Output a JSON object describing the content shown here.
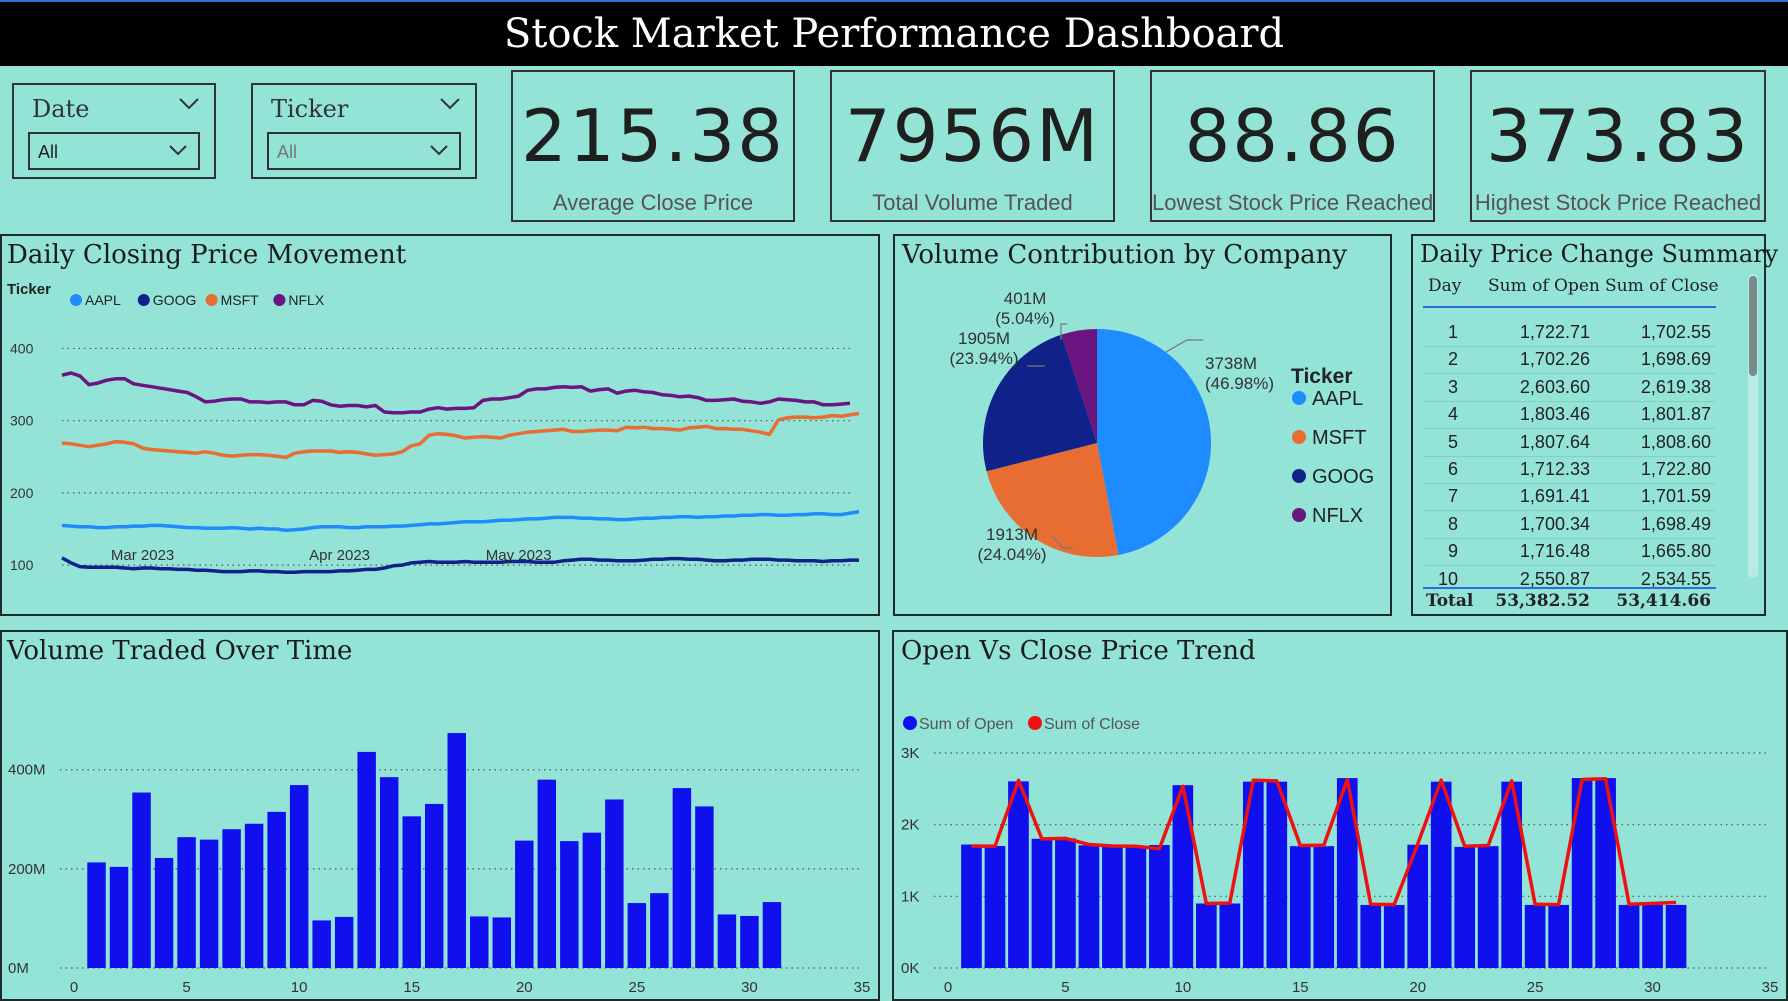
{
  "header": {
    "title": "Stock Market Performance Dashboard"
  },
  "filters": {
    "date": {
      "label": "Date",
      "value": "All"
    },
    "ticker": {
      "label": "Ticker",
      "value": "All"
    }
  },
  "kpis": [
    {
      "value": "215.38",
      "caption": "Average Close Price"
    },
    {
      "value": "7956M",
      "caption": "Total Volume Traded"
    },
    {
      "value": "88.86",
      "caption": "Lowest Stock Price Reached"
    },
    {
      "value": "373.83",
      "caption": "Highest Stock Price Reached"
    }
  ],
  "colors": {
    "AAPL": "#1e8bff",
    "GOOG": "#10228a",
    "MSFT": "#e86d32",
    "NFLX": "#6b1580",
    "bar": "#1010ee",
    "close_line": "#ee1111",
    "open_dot": "#1010ee"
  },
  "table": {
    "title": "Daily Price Change Summary",
    "columns": [
      "Day",
      "Sum of Open",
      "Sum of Close"
    ],
    "rows": [
      [
        "1",
        "1,722.71",
        "1,702.55"
      ],
      [
        "2",
        "1,702.26",
        "1,698.69"
      ],
      [
        "3",
        "2,603.60",
        "2,619.38"
      ],
      [
        "4",
        "1,803.46",
        "1,801.87"
      ],
      [
        "5",
        "1,807.64",
        "1,808.60"
      ],
      [
        "6",
        "1,712.33",
        "1,722.80"
      ],
      [
        "7",
        "1,691.41",
        "1,701.59"
      ],
      [
        "8",
        "1,700.34",
        "1,698.49"
      ],
      [
        "9",
        "1,716.48",
        "1,665.80"
      ],
      [
        "10",
        "2,550.87",
        "2,534.55"
      ]
    ],
    "total": [
      "Total",
      "53,382.52",
      "53,414.66"
    ]
  },
  "chart_data": [
    {
      "type": "line",
      "title": "Daily Closing Price Movement",
      "legend_title": "Ticker",
      "legend": [
        "AAPL",
        "GOOG",
        "MSFT",
        "NFLX"
      ],
      "x_ticks": [
        "Mar 2023",
        "Apr 2023",
        "May 2023"
      ],
      "x_tick_index": [
        9,
        31,
        51
      ],
      "ylim": [
        60,
        420
      ],
      "y_ticks": [
        "100",
        "200",
        "300",
        "400"
      ],
      "grid": true,
      "series": [
        {
          "name": "NFLX",
          "values": [
            363,
            366,
            362,
            350,
            352,
            356,
            358,
            358,
            351,
            349,
            347,
            345,
            343,
            341,
            339,
            333,
            326,
            327,
            329,
            330,
            330,
            326,
            326,
            325,
            326,
            326,
            322,
            322,
            328,
            327,
            322,
            320,
            321,
            321,
            319,
            321,
            312,
            311,
            311,
            312,
            312,
            316,
            318,
            316,
            317,
            317,
            318,
            328,
            330,
            330,
            332,
            334,
            342,
            344,
            344,
            346,
            347,
            346,
            347,
            341,
            343,
            344,
            338,
            341,
            342,
            340,
            339,
            336,
            335,
            333,
            334,
            332,
            328,
            328,
            329,
            330,
            327,
            326,
            324,
            326,
            330,
            329,
            328,
            326,
            326,
            322,
            322,
            323,
            324
          ]
        },
        {
          "name": "MSFT",
          "values": [
            269,
            268,
            266,
            264,
            266,
            268,
            271,
            270,
            268,
            262,
            260,
            259,
            258,
            257,
            256,
            255,
            257,
            255,
            252,
            251,
            252,
            253,
            253,
            252,
            251,
            249,
            255,
            257,
            258,
            258,
            258,
            256,
            257,
            256,
            254,
            252,
            253,
            254,
            257,
            265,
            268,
            280,
            282,
            281,
            279,
            276,
            277,
            278,
            277,
            276,
            280,
            282,
            284,
            285,
            286,
            287,
            288,
            285,
            285,
            286,
            287,
            287,
            286,
            291,
            290,
            291,
            289,
            289,
            288,
            287,
            290,
            291,
            292,
            289,
            289,
            288,
            288,
            286,
            284,
            281,
            301,
            304,
            305,
            305,
            304,
            305,
            307,
            306,
            308,
            310
          ]
        },
        {
          "name": "AAPL",
          "values": [
            155,
            154,
            153,
            153,
            152,
            152,
            153,
            153,
            154,
            154,
            155,
            155,
            154,
            153,
            152,
            152,
            151,
            151,
            151,
            152,
            151,
            150,
            151,
            150,
            150,
            148,
            149,
            150,
            152,
            153,
            153,
            153,
            152,
            152,
            153,
            153,
            153,
            154,
            154,
            155,
            156,
            157,
            157,
            158,
            159,
            160,
            160,
            160,
            161,
            162,
            162,
            163,
            164,
            164,
            165,
            166,
            166,
            166,
            165,
            165,
            164,
            164,
            163,
            163,
            164,
            165,
            165,
            166,
            166,
            167,
            167,
            166,
            167,
            167,
            168,
            168,
            169,
            169,
            170,
            170,
            169,
            169,
            170,
            170,
            171,
            171,
            170,
            170,
            172,
            174
          ]
        },
        {
          "name": "GOOG",
          "values": [
            110,
            103,
            98,
            97,
            97,
            97,
            97,
            96,
            95,
            96,
            96,
            95,
            95,
            94,
            94,
            93,
            93,
            92,
            91,
            91,
            91,
            92,
            92,
            91,
            91,
            90,
            90,
            91,
            91,
            91,
            91,
            92,
            92,
            93,
            94,
            94,
            96,
            99,
            100,
            103,
            104,
            105,
            104,
            104,
            104,
            105,
            104,
            104,
            104,
            104,
            105,
            105,
            105,
            104,
            104,
            104,
            106,
            107,
            108,
            108,
            107,
            107,
            106,
            106,
            106,
            107,
            108,
            108,
            109,
            109,
            108,
            108,
            107,
            106,
            106,
            107,
            107,
            108,
            108,
            108,
            107,
            107,
            106,
            106,
            106,
            105,
            106,
            106,
            107,
            107
          ]
        }
      ]
    },
    {
      "type": "pie",
      "title": "Volume Contribution by Company",
      "legend_title": "Ticker",
      "slices": [
        {
          "name": "AAPL",
          "value": 3738,
          "label": "3738M",
          "pct": "(46.98%)"
        },
        {
          "name": "MSFT",
          "value": 1913,
          "label": "1913M",
          "pct": "(24.04%)"
        },
        {
          "name": "GOOG",
          "value": 1905,
          "label": "1905M",
          "pct": "(23.94%)"
        },
        {
          "name": "NFLX",
          "value": 401,
          "label": "401M",
          "pct": "(5.04%)"
        }
      ]
    },
    {
      "type": "bar",
      "title": "Volume Traded Over Time",
      "x": [
        1,
        2,
        3,
        4,
        5,
        6,
        7,
        8,
        9,
        10,
        11,
        12,
        13,
        14,
        15,
        16,
        17,
        18,
        19,
        20,
        21,
        22,
        23,
        24,
        25,
        26,
        27,
        28,
        29,
        30,
        31
      ],
      "values": [
        213,
        204,
        354,
        222,
        264,
        259,
        280,
        291,
        315,
        369,
        96,
        103,
        436,
        385,
        306,
        331,
        474,
        104,
        102,
        257,
        380,
        256,
        273,
        340,
        131,
        151,
        363,
        326,
        108,
        105,
        133
      ],
      "xlim": [
        0,
        35
      ],
      "x_ticks": [
        "0",
        "5",
        "10",
        "15",
        "20",
        "25",
        "30",
        "35"
      ],
      "ylim": [
        0,
        460
      ],
      "y_ticks": [
        "0M",
        "200M",
        "400M"
      ],
      "grid": true
    },
    {
      "type": "bar",
      "title": "Open Vs Close Price Trend",
      "legend": [
        "Sum of Open",
        "Sum of Close"
      ],
      "x": [
        1,
        2,
        3,
        4,
        5,
        6,
        7,
        8,
        9,
        10,
        11,
        12,
        13,
        14,
        15,
        16,
        17,
        18,
        19,
        20,
        21,
        22,
        23,
        24,
        25,
        26,
        27,
        28,
        29,
        30,
        31
      ],
      "series": [
        {
          "name": "Sum of Open",
          "values": [
            1723,
            1702,
            2604,
            1803,
            1808,
            1712,
            1691,
            1700,
            1716,
            2551,
            900,
            900,
            2600,
            2600,
            1700,
            1700,
            2650,
            880,
            880,
            1720,
            2600,
            1690,
            1700,
            2600,
            880,
            880,
            2650,
            2650,
            880,
            880,
            880
          ]
        },
        {
          "name": "Sum of Close",
          "values": [
            1703,
            1699,
            2619,
            1802,
            1809,
            1723,
            1702,
            1698,
            1666,
            2535,
            900,
            905,
            2620,
            2610,
            1710,
            1712,
            2630,
            890,
            885,
            1730,
            2620,
            1700,
            1710,
            2610,
            890,
            885,
            2630,
            2640,
            890,
            900,
            915
          ]
        }
      ],
      "xlim": [
        0,
        35
      ],
      "x_ticks": [
        "0",
        "5",
        "10",
        "15",
        "20",
        "25",
        "30",
        "35"
      ],
      "ylim": [
        0,
        3000
      ],
      "y_ticks": [
        "0K",
        "1K",
        "2K",
        "3K"
      ],
      "grid": true
    }
  ]
}
